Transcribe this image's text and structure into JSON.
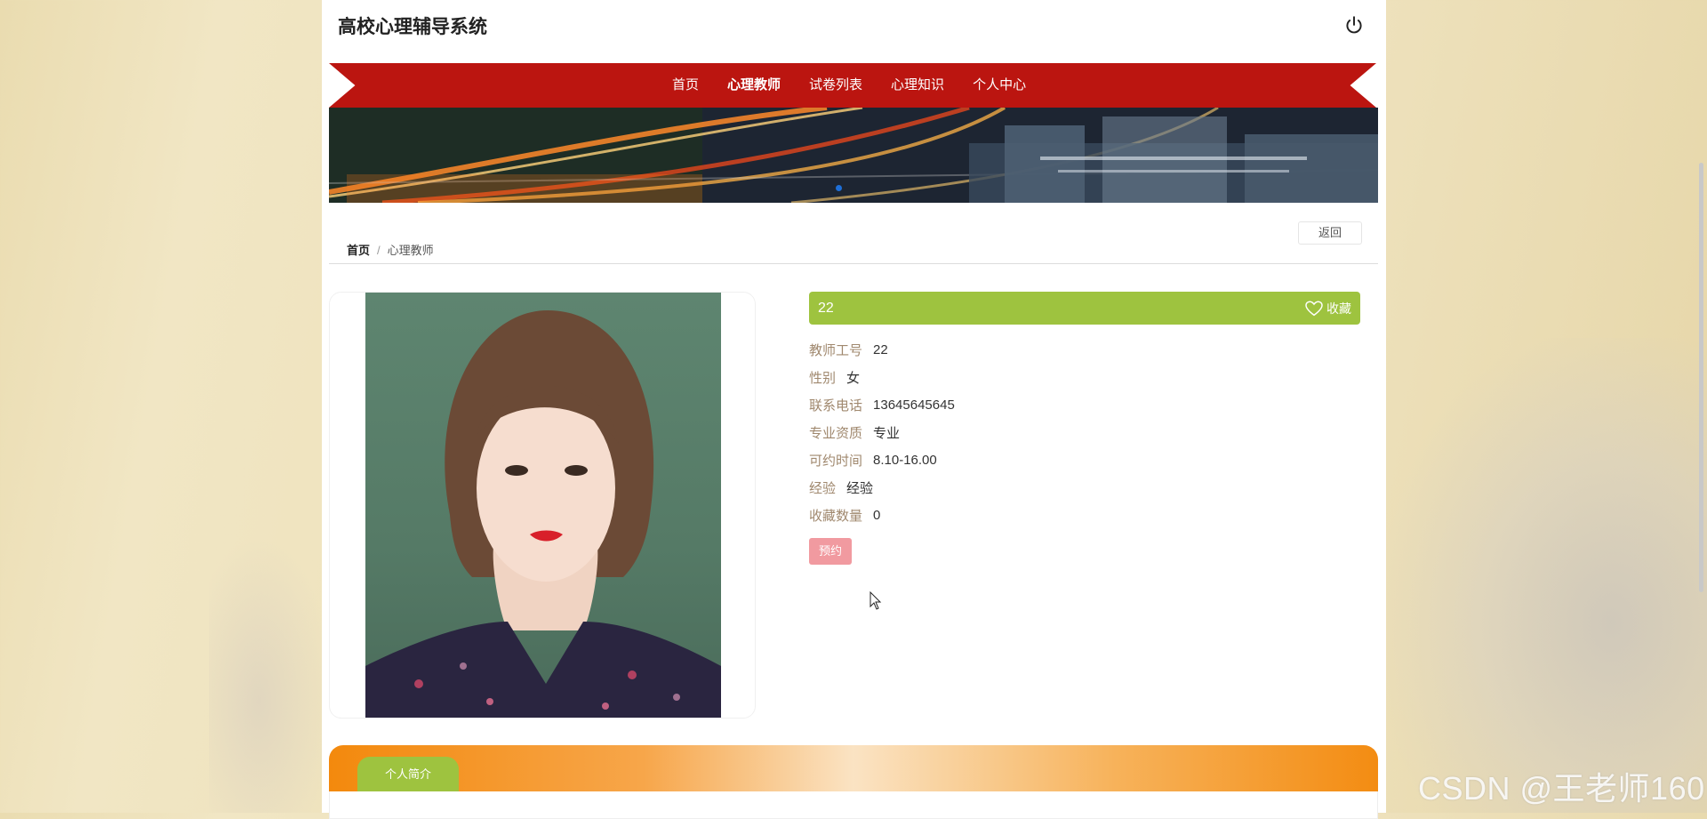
{
  "app": {
    "title": "高校心理辅导系统"
  },
  "header": {
    "power_icon": "power-icon"
  },
  "nav": {
    "items": [
      {
        "label": "首页",
        "active": false
      },
      {
        "label": "心理教师",
        "active": true
      },
      {
        "label": "试卷列表",
        "active": false
      },
      {
        "label": "心理知识",
        "active": false
      },
      {
        "label": "个人中心",
        "active": false
      }
    ]
  },
  "banner": {
    "dots": 2,
    "active_dot": 1
  },
  "breadcrumb": {
    "home": "首页",
    "separator": "/",
    "current": "心理教师"
  },
  "back_label": "返回",
  "teacher": {
    "name": "22",
    "favorite_label": "收藏",
    "fields": [
      {
        "label": "教师工号",
        "value": "22"
      },
      {
        "label": "性别",
        "value": "女"
      },
      {
        "label": "联系电话",
        "value": "13645645645"
      },
      {
        "label": "专业资质",
        "value": "专业"
      },
      {
        "label": "可约时间",
        "value": "8.10-16.00"
      },
      {
        "label": "经验",
        "value": "经验"
      },
      {
        "label": "收藏数量",
        "value": "0"
      }
    ],
    "book_label": "预约"
  },
  "intro_tab": "个人简介",
  "watermark": "CSDN @王老师160",
  "colors": {
    "nav_red": "#bb1510",
    "title_green": "#9ec33f",
    "book_pink": "#f19aa0",
    "intro_orange": "#f3890d",
    "label_brown": "#a0886e"
  }
}
